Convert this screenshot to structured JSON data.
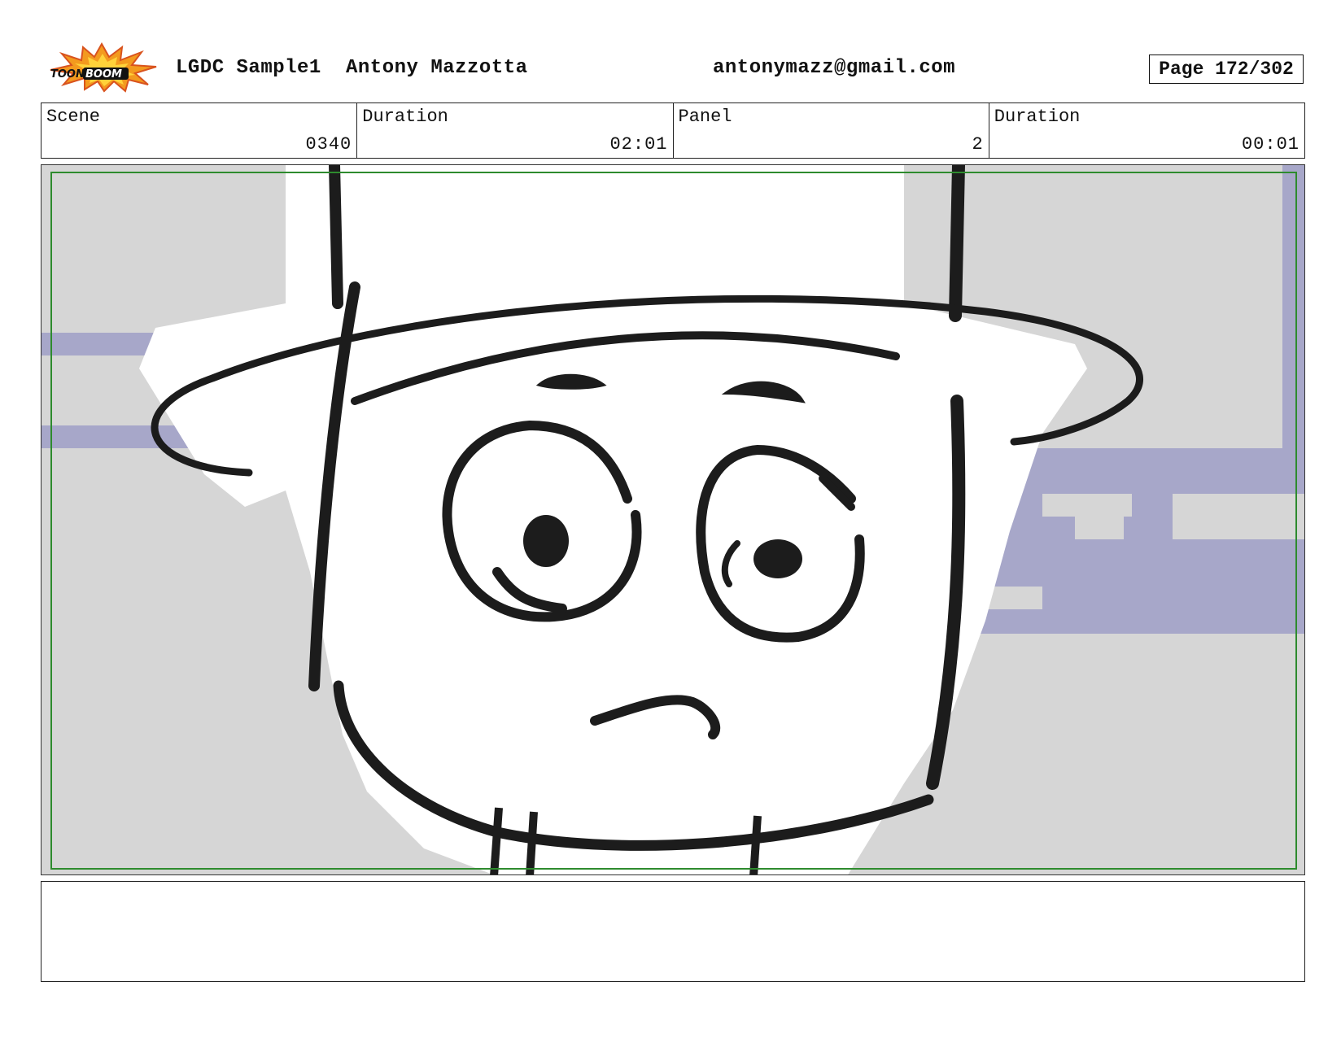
{
  "header": {
    "logo_text": "TOONBOOM",
    "project": "LGDC Sample1",
    "author": "Antony Mazzotta",
    "email": "antonymazz@gmail.com",
    "page": "Page 172/302"
  },
  "info": {
    "scene_label": "Scene",
    "scene_value": "0340",
    "scene_duration_label": "Duration",
    "scene_duration_value": "02:01",
    "panel_label": "Panel",
    "panel_value": "2",
    "panel_duration_label": "Duration",
    "panel_duration_value": "00:01"
  },
  "notes": {
    "text": ""
  },
  "colors": {
    "background_gray": "#d6d6d6",
    "stripe_blue": "#a7a7c9",
    "safe_frame": "#2e8b2e",
    "ink": "#1c1c1c",
    "logo_orange": "#f39a1e"
  }
}
